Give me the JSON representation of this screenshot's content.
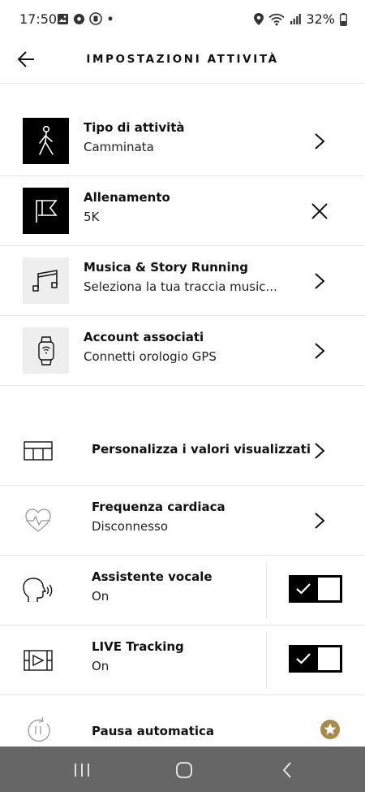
{
  "status_bar": {
    "time": "17:50",
    "battery": "32%",
    "icons_left": [
      "image-icon",
      "soccer-ball-icon",
      "app-icon",
      "dot-icon"
    ],
    "icons_right": [
      "location-icon",
      "wifi-icon",
      "signal-icon",
      "battery-icon"
    ]
  },
  "header": {
    "title": "IMPOSTAZIONI ATTIVITÀ",
    "back_icon": "arrow-left-icon"
  },
  "activity_items": [
    {
      "title": "Tipo di attività",
      "subtitle": "Camminata",
      "icon": "walking-person-icon",
      "action": "chevron-right-icon"
    },
    {
      "title": "Allenamento",
      "subtitle": "5K",
      "icon": "flag-icon",
      "action": "close-icon"
    },
    {
      "title": "Musica & Story Running",
      "subtitle": "Seleziona la tua traccia music...",
      "icon": "music-note-icon",
      "action": "chevron-right-icon"
    },
    {
      "title": "Account associati",
      "subtitle": "Connetti orologio GPS",
      "icon": "smartwatch-icon",
      "action": "chevron-right-icon"
    }
  ],
  "settings_items": [
    {
      "title": "Personalizza i valori visualizzati",
      "icon": "grid-layout-icon",
      "action": "chevron-right-icon"
    },
    {
      "title": "Frequenza cardiaca",
      "subtitle": "Disconnesso",
      "icon": "heart-rate-icon",
      "action": "chevron-right-icon"
    },
    {
      "title": "Assistente vocale",
      "subtitle": "On",
      "icon": "voice-head-icon",
      "toggle": true
    },
    {
      "title": "LIVE Tracking",
      "subtitle": "On",
      "icon": "live-tracking-icon",
      "toggle": true
    },
    {
      "title": "Pausa automatica",
      "icon": "pause-icon",
      "badge": "star-badge-icon",
      "badge_color": "#a88b4a"
    }
  ],
  "nav_bar": {
    "buttons": [
      "recent-apps-icon",
      "home-icon",
      "back-icon"
    ]
  }
}
